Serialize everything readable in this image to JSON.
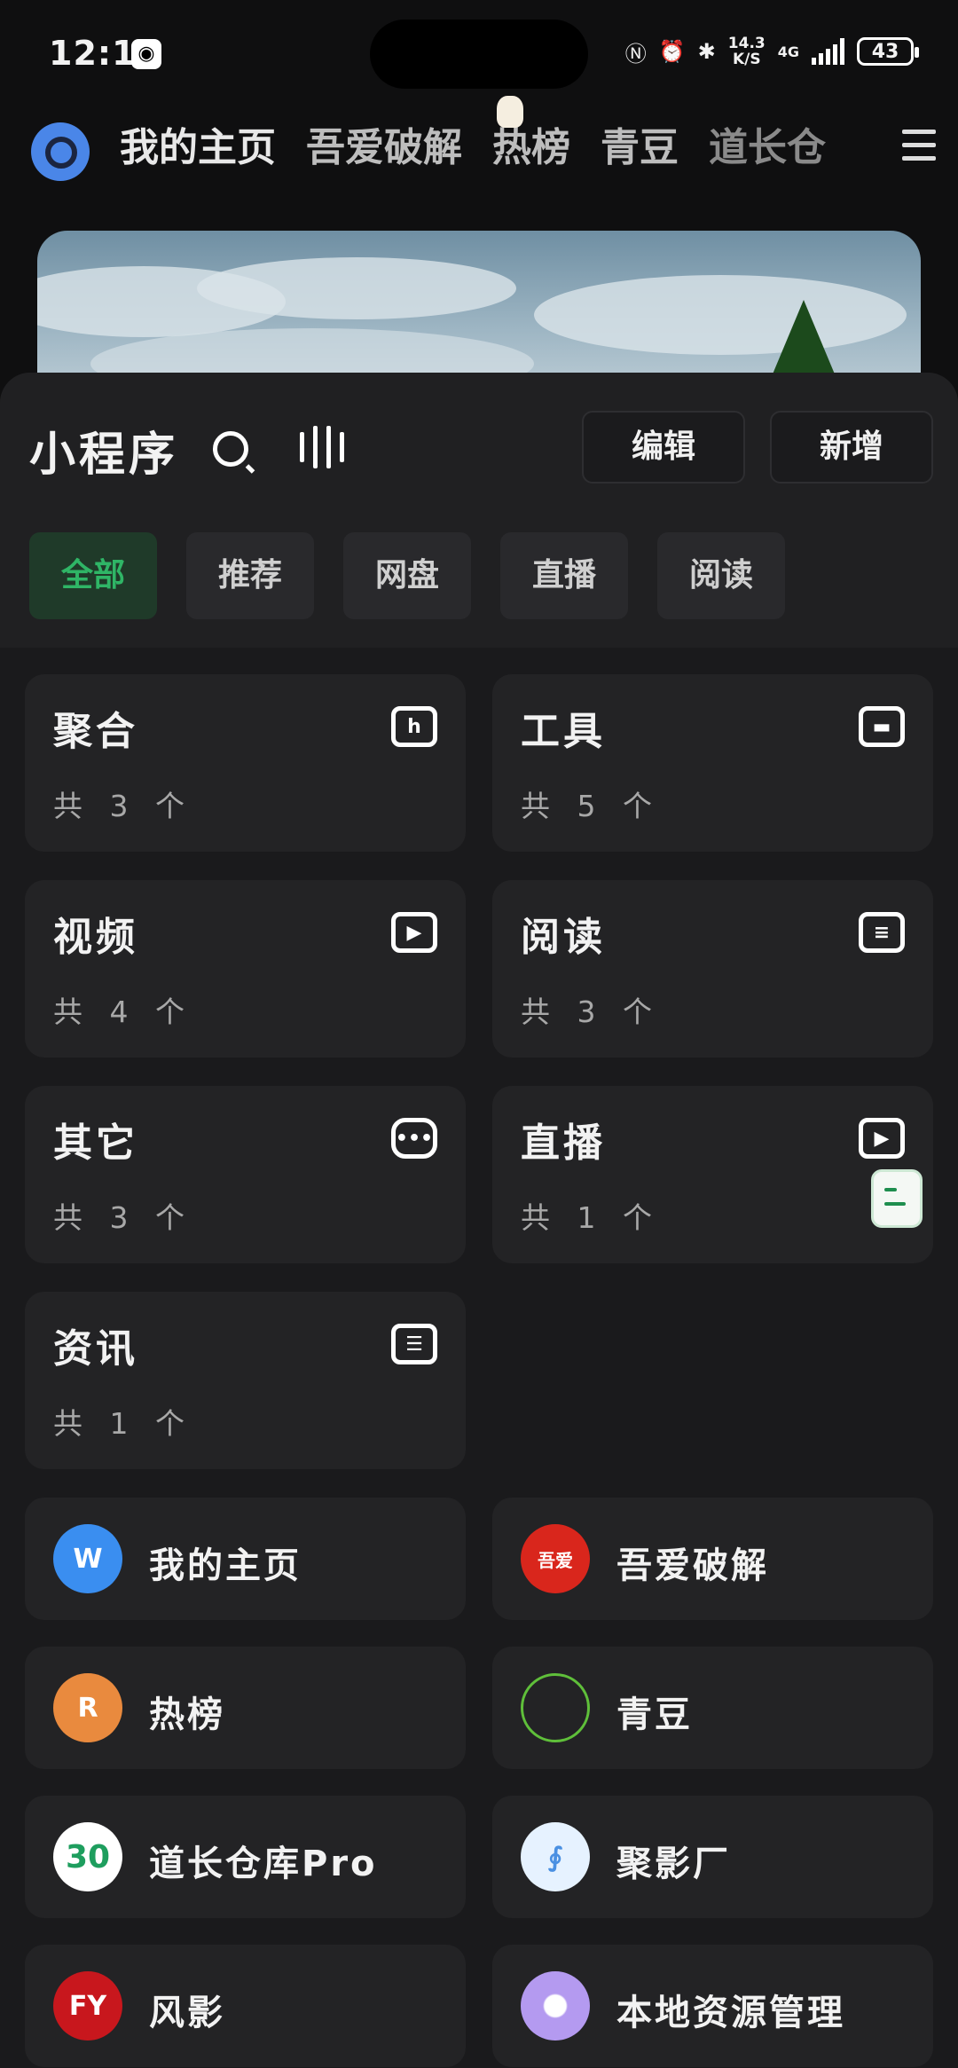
{
  "status": {
    "time": "12:13",
    "speed_top": "14.3",
    "speed_bottom": "K/S",
    "net_type": "4G",
    "battery": "43"
  },
  "topnav": {
    "tabs": [
      "我的主页",
      "吾爱破解",
      "热榜",
      "青豆",
      "道长仓"
    ]
  },
  "sheet": {
    "title": "小程序",
    "edit_label": "编辑",
    "add_label": "新增",
    "chips": [
      "全部",
      "推荐",
      "网盘",
      "直播",
      "阅读"
    ]
  },
  "categories": [
    {
      "name": "聚合",
      "count": "共 3 个",
      "icon": "h-box-icon"
    },
    {
      "name": "工具",
      "count": "共 5 个",
      "icon": "toolbox-icon"
    },
    {
      "name": "视频",
      "count": "共 4 个",
      "icon": "play-icon"
    },
    {
      "name": "阅读",
      "count": "共 3 个",
      "icon": "book-icon"
    },
    {
      "name": "其它",
      "count": "共 3 个",
      "icon": "more-icon"
    },
    {
      "name": "直播",
      "count": "共 1 个",
      "icon": "tv-icon"
    },
    {
      "name": "资讯",
      "count": "共 1 个",
      "icon": "news-icon"
    }
  ],
  "apps": [
    {
      "name": "我的主页",
      "badge": "W",
      "color": "#3a8ef0"
    },
    {
      "name": "吾爱破解",
      "badge": "吾爱",
      "color": "#d9261c"
    },
    {
      "name": "热榜",
      "badge": "R",
      "color": "#e98a3e"
    },
    {
      "name": "青豆",
      "badge": "",
      "color": "#232325"
    },
    {
      "name": "道长仓库Pro",
      "badge": "30",
      "color": "#ffffff"
    },
    {
      "name": "聚影厂",
      "badge": "",
      "color": "#e6f2ff"
    },
    {
      "name": "风影",
      "badge": "FY",
      "color": "#c8171d"
    },
    {
      "name": "本地资源管理",
      "badge": "",
      "color": "#b49af0"
    }
  ]
}
